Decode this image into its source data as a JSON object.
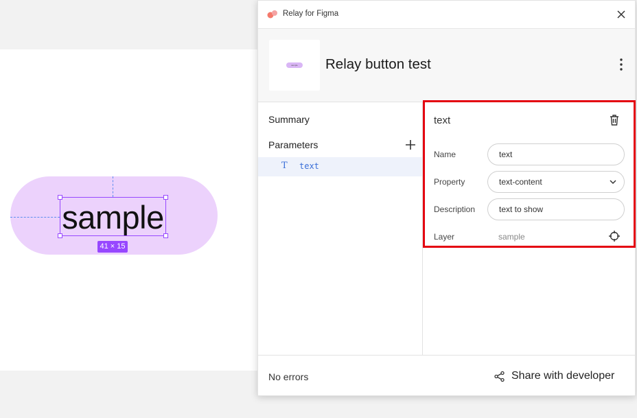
{
  "canvas": {
    "component_text": "sample",
    "dimensions_badge": "41 × 15"
  },
  "panel": {
    "app_title": "Relay for Figma",
    "thumbnail_text": "sample",
    "component_title": "Relay button test",
    "nav": {
      "summary": "Summary",
      "parameters": "Parameters",
      "param_icon": "T",
      "param_name": "text"
    },
    "detail": {
      "title": "text",
      "fields": {
        "name_label": "Name",
        "name_value": "text",
        "property_label": "Property",
        "property_value": "text-content",
        "description_label": "Description",
        "description_value": "text to show",
        "layer_label": "Layer",
        "layer_value": "sample"
      }
    },
    "footer": {
      "status": "No errors",
      "share_label": "Share with developer"
    }
  },
  "colors": {
    "pill": "#ecd2fc",
    "selection": "#9747ff",
    "accent": "#3b6fd8",
    "highlight": "#e4000f"
  }
}
